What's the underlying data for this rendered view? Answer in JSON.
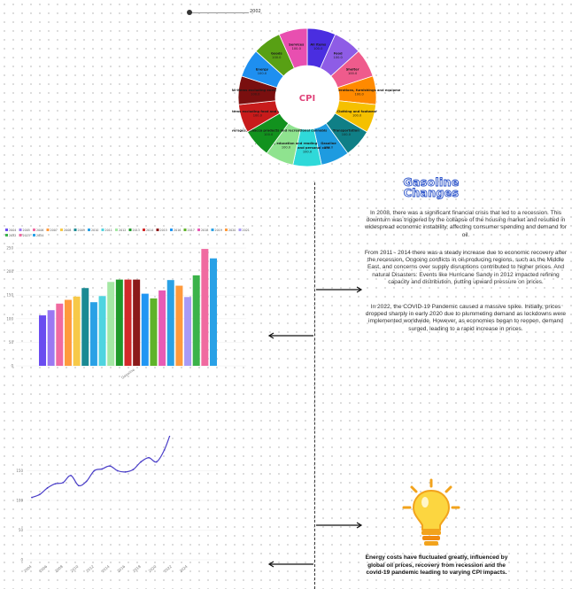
{
  "slider": {
    "value_label": "2002"
  },
  "header": {
    "title_line1": "Gasoline",
    "title_line2": "Changes"
  },
  "paragraphs": [
    "In 2008, there was a significant financial crisis that led to a recession. This downturn was triggered by the collapse of the housing market and resulted in widespread economic instability, affecting consumer spending and demand for oil.",
    "From 2011 - 2014 there was a steady increase due to economic recovery after the recession, Ongoing conflicts in oil-producing regions, such as the Middle East, and concerns over supply disruptions contributed to higher prices. And natural Disasters: Events like Hurricane Sandy in 2012 impacted refining capacity and distribution, putting upward pressure on prices.",
    "In 2022, the COVID-19 Pandemic caused a massive spike. Initially, prices dropped sharply in early 2020 due to plummeting demand as lockdowns were implemented worldwide. However, as economies began to reopen, demand surged, leading to a rapid increase in prices."
  ],
  "energy_note": "Energy costs have fluctuated greatly, influenced by global oil prices, recovery from recession and the covid-19 pandemic leading to varying CPI impacts.",
  "chart_data": [
    {
      "type": "pie",
      "center_label": "CPI",
      "slices": [
        {
          "label": "All items",
          "value": 100.0,
          "color": "#4a2ee0"
        },
        {
          "label": "Food",
          "value": 100.0,
          "color": "#8e5ce6"
        },
        {
          "label": "Shelter",
          "value": 100.0,
          "color": "#ef5b8c"
        },
        {
          "label": "Household operations, furnishings and equipment",
          "value": 100.0,
          "color": "#ff8a00"
        },
        {
          "label": "Clothing and footwear",
          "value": 100.0,
          "color": "#f5c000"
        },
        {
          "label": "Transportation",
          "value": 100.0,
          "color": "#0f7f86"
        },
        {
          "label": "Gasoline",
          "value": 100.0,
          "color": "#1e9be0"
        },
        {
          "label": "Health and personal care",
          "value": 100.0,
          "color": "#2fd9d9"
        },
        {
          "label": "Recreation, education and reading",
          "value": 100.0,
          "color": "#8fe38f"
        },
        {
          "label": "Alcoholic beverages, tobacco products and recreational cannabis",
          "value": 100.0,
          "color": "#12921e"
        },
        {
          "label": "All-items excluding food and energy",
          "value": 100.0,
          "color": "#c81b1b"
        },
        {
          "label": "All-items excluding energy",
          "value": 100.0,
          "color": "#7a0f0f"
        },
        {
          "label": "Energy",
          "value": 100.0,
          "color": "#1e8ff0"
        },
        {
          "label": "Goods",
          "value": 100.0,
          "color": "#58a014"
        },
        {
          "label": "Services",
          "value": 100.0,
          "color": "#e84fb0"
        }
      ]
    },
    {
      "type": "bar",
      "categories": [
        "Gasoline"
      ],
      "ylim": [
        0,
        250
      ],
      "yticks": [
        0,
        50,
        100,
        150,
        200,
        250
      ],
      "series": [
        {
          "name": "2004",
          "value": 107,
          "color": "#6a4cf0"
        },
        {
          "name": "2005",
          "value": 118,
          "color": "#9b78f2"
        },
        {
          "name": "2006",
          "value": 132,
          "color": "#f06aa0"
        },
        {
          "name": "2007",
          "value": 140,
          "color": "#ff9a3c"
        },
        {
          "name": "2008",
          "value": 147,
          "color": "#f7c948"
        },
        {
          "name": "2009",
          "value": 165,
          "color": "#1a8a93"
        },
        {
          "name": "2010",
          "value": 135,
          "color": "#2aa1e6"
        },
        {
          "name": "2011",
          "value": 148,
          "color": "#4fd4e0"
        },
        {
          "name": "2012",
          "value": 178,
          "color": "#a4e8a4"
        },
        {
          "name": "2013",
          "value": 183,
          "color": "#1f9a2a"
        },
        {
          "name": "2014",
          "value": 183,
          "color": "#d22a2a"
        },
        {
          "name": "2015",
          "value": 183,
          "color": "#8b1a1a"
        },
        {
          "name": "2016",
          "value": 153,
          "color": "#2196f3"
        },
        {
          "name": "2017",
          "value": 143,
          "color": "#5fb32a"
        },
        {
          "name": "2018",
          "value": 160,
          "color": "#e85bb5"
        },
        {
          "name": "2019",
          "value": 182,
          "color": "#2aa1e6"
        },
        {
          "name": "2020",
          "value": 170,
          "color": "#ff9a3c"
        },
        {
          "name": "2021",
          "value": 146,
          "color": "#a89af5"
        },
        {
          "name": "2022",
          "value": 192,
          "color": "#3bb34a"
        },
        {
          "name": "2023",
          "value": 248,
          "color": "#f06aa0"
        },
        {
          "name": "2024",
          "value": 228,
          "color": "#2aa1e6"
        }
      ]
    },
    {
      "type": "line",
      "ylim": [
        0,
        200
      ],
      "yticks": [
        0,
        50,
        100,
        150
      ],
      "series": [
        {
          "name": "Energy",
          "color": "#4a3ec8",
          "x": [
            "2004",
            "2005",
            "2006",
            "2007",
            "2008",
            "2009",
            "2010",
            "2011",
            "2012",
            "2013",
            "2014",
            "2015",
            "2016",
            "2017",
            "2018",
            "2019",
            "2020",
            "2021",
            "2022",
            "2023",
            "2024"
          ],
          "y": [
            105,
            110,
            121,
            128,
            130,
            142,
            125,
            132,
            150,
            153,
            158,
            150,
            148,
            152,
            165,
            172,
            165,
            185,
            220,
            252,
            238
          ]
        }
      ],
      "xtick_labels": [
        "2004",
        "2006",
        "2008",
        "2010",
        "2012",
        "2014",
        "2016",
        "2018",
        "2020",
        "2022",
        "2024"
      ]
    }
  ]
}
